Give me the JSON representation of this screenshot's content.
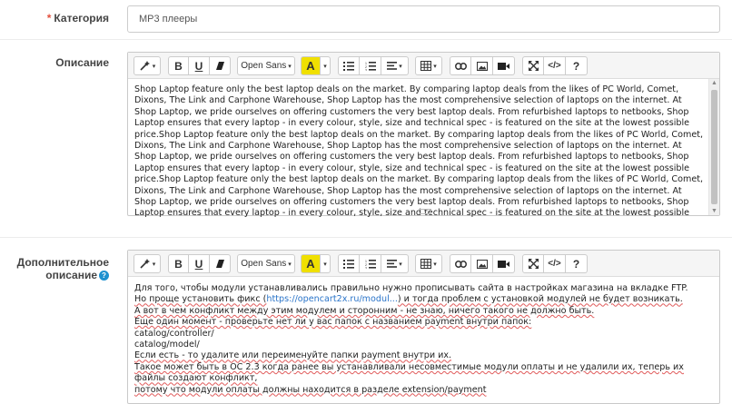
{
  "category": {
    "label": "Категория",
    "value": "MP3 плееры"
  },
  "description": {
    "label": "Описание",
    "text": "Shop Laptop feature only the best laptop deals on the market. By comparing laptop deals from the likes of PC World, Comet, Dixons, The Link and Carphone Warehouse, Shop Laptop has the most comprehensive selection of laptops on the internet. At Shop Laptop, we pride ourselves on offering customers the very best laptop deals. From refurbished laptops to netbooks, Shop Laptop ensures that every laptop - in every colour, style, size and technical spec - is featured on the site at the lowest possible price.Shop Laptop feature only the best laptop deals on the market. By comparing laptop deals from the likes of PC World, Comet, Dixons, The Link and Carphone Warehouse, Shop Laptop has the most comprehensive selection of laptops on the internet. At Shop Laptop, we pride ourselves on offering customers the very best laptop deals. From refurbished laptops to netbooks, Shop Laptop ensures that every laptop - in every colour, style, size and technical spec - is featured on the site at the lowest possible price.Shop Laptop feature only the best laptop deals on the market. By comparing laptop deals from the likes of PC World, Comet, Dixons, The Link and Carphone Warehouse, Shop Laptop has the most comprehensive selection of laptops on the internet. At Shop Laptop, we pride ourselves on offering customers the very best laptop deals. From refurbished laptops to netbooks, Shop Laptop ensures that every laptop - in every colour, style, size and technical spec - is featured on the site at the lowest possible price.Shop Laptop feature only the best laptop deals on the market."
  },
  "additional": {
    "label_line1": "Дополнительное",
    "label_line2": "описание",
    "lines": [
      "Для того, чтобы модули устанавливались правильно нужно прописывать сайта в настройках магазина на вкладке FTP.",
      "Но проще установить фикс (",
      "https://opencart2x.ru/modul...",
      ") и тогда проблем с установкой модулей не будет возникать.",
      "А вот в чем конфликт между этим модулем и сторонним - не знаю, ничего такого не должно быть.",
      "Еще один момент - проверьте нет ли у вас папок с названием payment внутри папок:",
      "catalog/controller/",
      "catalog/model/",
      "Если есть - то удалите или переименуйте папки payment внутри их.",
      "Такое может быть в ОС 2.3 когда ранее вы устанавливали несовместимые модули оплаты и не удалили их, теперь их файлы создают конфликт,",
      "потому что модули оплаты должны находится в разделе extension/payment"
    ]
  },
  "toolbar": {
    "style_icon": "magic-wand-icon",
    "bold": "B",
    "underline": "U",
    "eraser_icon": "eraser-icon",
    "font": "Open Sans",
    "color_letter": "A",
    "ul_icon": "unordered-list-icon",
    "ol_icon": "ordered-list-icon",
    "align_icon": "align-icon",
    "table_icon": "table-icon",
    "link_icon": "link-icon",
    "image_icon": "image-icon",
    "video_icon": "video-icon",
    "fullscreen_icon": "fullscreen-icon",
    "code": "</>",
    "help": "?"
  },
  "colors": {
    "required": "#e3503e",
    "link": "#2a74c9",
    "highlight": "#f0e000",
    "help_badge": "#1e91cf"
  }
}
